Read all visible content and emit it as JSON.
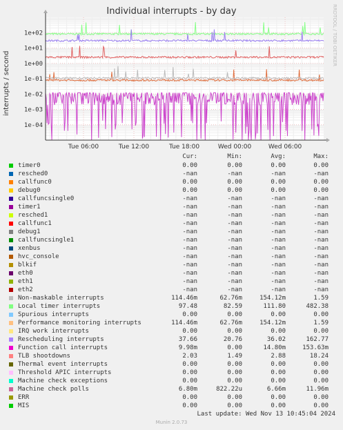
{
  "chart_data": {
    "type": "line",
    "title": "Individual interrupts - by day",
    "ylabel": "interrupts / second",
    "y_scale": "log",
    "ylim": [
      1e-05,
      1000
    ],
    "y_ticks": [
      "1e-04",
      "1e-03",
      "1e-02",
      "1e-01",
      "1e+00",
      "1e+01",
      "1e+02"
    ],
    "x_ticks": [
      "Tue 06:00",
      "Tue 12:00",
      "Tue 18:00",
      "Wed 00:00",
      "Wed 06:00"
    ],
    "grid": true,
    "side_label": "RRDTOOL / TOBI OETIKER",
    "series": [
      {
        "name": "Local timer interrupts",
        "color": "#88ff88",
        "base": 82,
        "min": 82.59,
        "max": 482.38
      },
      {
        "name": "Rescheduling interrupts",
        "color": "#9a7ff0",
        "base": 30,
        "min": 20.76,
        "max": 162.77
      },
      {
        "name": "TLB shootdowns",
        "color": "#e06060",
        "base": 2.5,
        "min": 1.49,
        "max": 18.24
      },
      {
        "name": "Function call interrupts",
        "color": "#e07040",
        "base": 0.08,
        "min": 0,
        "max": 153.63
      },
      {
        "name": "Machine check polls",
        "color": "#cc44cc",
        "base": 0.006,
        "min": 0.000822,
        "max": 0.01196
      },
      {
        "name": "Non-maskable interrupts",
        "color": "#bbbbbb",
        "base": 0.11,
        "min": 0.06276,
        "max": 1.59
      }
    ]
  },
  "legend": {
    "headers": {
      "cur": "Cur:",
      "min": "Min:",
      "avg": "Avg:",
      "max": "Max:"
    },
    "rows": [
      {
        "name": "timer0",
        "color": "#00cc00",
        "cur": "0.00",
        "min": "0.00",
        "avg": "0.00",
        "max": "0.00"
      },
      {
        "name": "resched0",
        "color": "#0066b3",
        "cur": "-nan",
        "min": "-nan",
        "avg": "-nan",
        "max": "-nan"
      },
      {
        "name": "callfunc0",
        "color": "#ff8000",
        "cur": "0.00",
        "min": "0.00",
        "avg": "0.00",
        "max": "0.00"
      },
      {
        "name": "debug0",
        "color": "#ffcc00",
        "cur": "0.00",
        "min": "0.00",
        "avg": "0.00",
        "max": "0.00"
      },
      {
        "name": "callfuncsingle0",
        "color": "#330099",
        "cur": "-nan",
        "min": "-nan",
        "avg": "-nan",
        "max": "-nan"
      },
      {
        "name": "timer1",
        "color": "#990099",
        "cur": "-nan",
        "min": "-nan",
        "avg": "-nan",
        "max": "-nan"
      },
      {
        "name": "resched1",
        "color": "#ccff00",
        "cur": "-nan",
        "min": "-nan",
        "avg": "-nan",
        "max": "-nan"
      },
      {
        "name": "callfunc1",
        "color": "#ff0000",
        "cur": "-nan",
        "min": "-nan",
        "avg": "-nan",
        "max": "-nan"
      },
      {
        "name": "debug1",
        "color": "#808080",
        "cur": "-nan",
        "min": "-nan",
        "avg": "-nan",
        "max": "-nan"
      },
      {
        "name": "callfuncsingle1",
        "color": "#008f00",
        "cur": "-nan",
        "min": "-nan",
        "avg": "-nan",
        "max": "-nan"
      },
      {
        "name": "xenbus",
        "color": "#00487d",
        "cur": "-nan",
        "min": "-nan",
        "avg": "-nan",
        "max": "-nan"
      },
      {
        "name": "hvc_console",
        "color": "#b35a00",
        "cur": "-nan",
        "min": "-nan",
        "avg": "-nan",
        "max": "-nan"
      },
      {
        "name": "blkif",
        "color": "#b38f00",
        "cur": "-nan",
        "min": "-nan",
        "avg": "-nan",
        "max": "-nan"
      },
      {
        "name": "eth0",
        "color": "#6b006b",
        "cur": "-nan",
        "min": "-nan",
        "avg": "-nan",
        "max": "-nan"
      },
      {
        "name": "eth1",
        "color": "#8fb300",
        "cur": "-nan",
        "min": "-nan",
        "avg": "-nan",
        "max": "-nan"
      },
      {
        "name": "eth2",
        "color": "#b30000",
        "cur": "-nan",
        "min": "-nan",
        "avg": "-nan",
        "max": "-nan"
      },
      {
        "name": "Non-maskable interrupts",
        "color": "#bebebe",
        "cur": "114.46m",
        "min": "62.76m",
        "avg": "154.12m",
        "max": "1.59"
      },
      {
        "name": "Local timer interrupts",
        "color": "#80ff80",
        "cur": "97.48",
        "min": "82.59",
        "avg": "111.80",
        "max": "482.38"
      },
      {
        "name": "Spurious interrupts",
        "color": "#80c9ff",
        "cur": "0.00",
        "min": "0.00",
        "avg": "0.00",
        "max": "0.00"
      },
      {
        "name": "Performance monitoring interrupts",
        "color": "#ffc080",
        "cur": "114.46m",
        "min": "62.76m",
        "avg": "154.12m",
        "max": "1.59"
      },
      {
        "name": "IRQ work interrupts",
        "color": "#ffe680",
        "cur": "0.00",
        "min": "0.00",
        "avg": "0.00",
        "max": "0.00"
      },
      {
        "name": "Rescheduling interrupts",
        "color": "#aa80ff",
        "cur": "37.66",
        "min": "20.76",
        "avg": "36.02",
        "max": "162.77"
      },
      {
        "name": "Function call interrupts",
        "color": "#ee00cc",
        "cur": "9.98m",
        "min": "0.00",
        "avg": "14.80m",
        "max": "153.63m"
      },
      {
        "name": "TLB shootdowns",
        "color": "#ff8080",
        "cur": "2.03",
        "min": "1.49",
        "avg": "2.88",
        "max": "18.24"
      },
      {
        "name": "Thermal event interrupts",
        "color": "#666600",
        "cur": "0.00",
        "min": "0.00",
        "avg": "0.00",
        "max": "0.00"
      },
      {
        "name": "Threshold APIC interrupts",
        "color": "#ffbfff",
        "cur": "0.00",
        "min": "0.00",
        "avg": "0.00",
        "max": "0.00"
      },
      {
        "name": "Machine check exceptions",
        "color": "#00ffcc",
        "cur": "0.00",
        "min": "0.00",
        "avg": "0.00",
        "max": "0.00"
      },
      {
        "name": "Machine check polls",
        "color": "#cc6699",
        "cur": "6.80m",
        "min": "822.22u",
        "avg": "6.66m",
        "max": "11.96m"
      },
      {
        "name": "ERR",
        "color": "#999900",
        "cur": "0.00",
        "min": "0.00",
        "avg": "0.00",
        "max": "0.00"
      },
      {
        "name": "MIS",
        "color": "#00cc00",
        "cur": "0.00",
        "min": "0.00",
        "avg": "0.00",
        "max": "0.00"
      }
    ]
  },
  "last_update": "Last update: Wed Nov 13 10:45:04 2024",
  "footer": "Munin 2.0.73"
}
